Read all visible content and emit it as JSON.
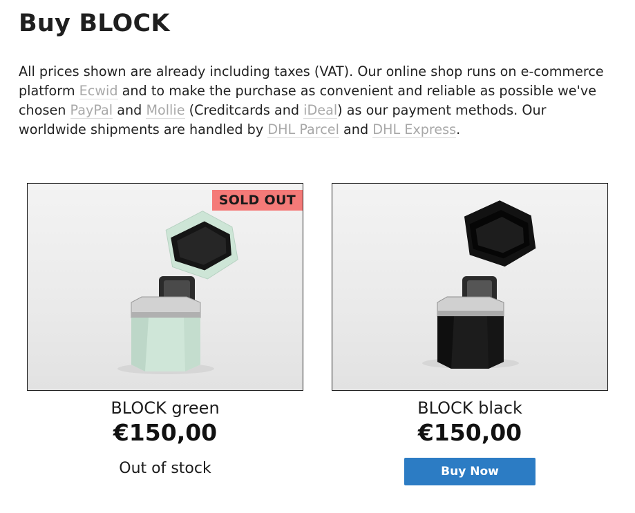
{
  "page": {
    "title": "Buy BLOCK"
  },
  "intro": {
    "t1": "All prices shown are already including taxes (VAT). Our online shop runs on e-commerce platform ",
    "link_ecwid": "Ecwid",
    "t2": " and to make the purchase as convenient and reliable as possible we've chosen ",
    "link_paypal": "PayPal",
    "t3": " and ",
    "link_mollie": "Mollie",
    "t4": " (Creditcards and ",
    "link_ideal": "iDeal",
    "t5": ") as our payment methods. Our worldwide shipments are handled by ",
    "link_dhl_parcel": "DHL Parcel",
    "t6": " and ",
    "link_dhl_express": "DHL Express",
    "t7": "."
  },
  "products": [
    {
      "name": "BLOCK green",
      "price": "€150,00",
      "badge": "SOLD OUT",
      "status": "Out of stock",
      "color": "#cfe6d8",
      "image_icon": "product-photo-green"
    },
    {
      "name": "BLOCK black",
      "price": "€150,00",
      "button": "Buy Now",
      "color": "#1b1b1b",
      "image_icon": "product-photo-black"
    }
  ],
  "colors": {
    "button": "#2c7cc4",
    "badge": "#f47a78",
    "link": "#a8a8a8"
  }
}
